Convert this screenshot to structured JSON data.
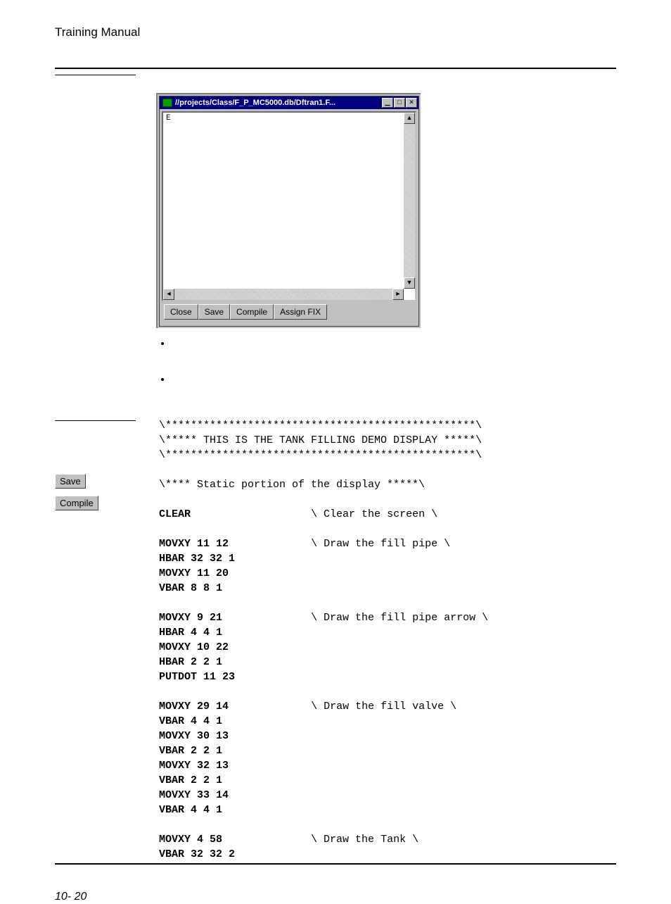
{
  "header": {
    "title": "Training Manual"
  },
  "window": {
    "title": "//projects/Class/F_P_MC5000.db/Dftran1.F...",
    "textpane_content": "E",
    "buttons": {
      "close": "Close",
      "save": "Save",
      "compile": "Compile",
      "assign": "Assign FIX"
    }
  },
  "bullets": {
    "b1": "",
    "b2": ""
  },
  "sidebar": {
    "btn_save": "Save",
    "btn_compile": "Compile"
  },
  "code": {
    "sep1": "\\*************************************************\\",
    "title": "\\***** THIS IS THE TANK FILLING DEMO DISPLAY *****\\",
    "sep2": "\\*************************************************\\",
    "static": "\\**** Static portion of the display *****\\",
    "clear": "CLEAR",
    "clear_c": "\\ Clear the screen \\",
    "fp1": "MOVXY 11 12",
    "fp1c": "\\ Draw the fill pipe \\",
    "fp2": "HBAR 32 32 1",
    "fp3": "MOVXY 11 20",
    "fp4": "VBAR 8 8 1",
    "fa1": "MOVXY 9 21",
    "fa1c": "\\ Draw the fill pipe arrow \\",
    "fa2": "HBAR 4 4 1",
    "fa3": "MOVXY 10 22",
    "fa4": "HBAR 2 2 1",
    "fa5": "PUTDOT 11 23",
    "fv1": "MOVXY 29 14",
    "fv1c": "\\ Draw the fill valve \\",
    "fv2": "VBAR 4 4 1",
    "fv3": "MOVXY 30 13",
    "fv4": "VBAR 2 2 1",
    "fv5": "MOVXY 32 13",
    "fv6": "VBAR 2 2 1",
    "fv7": "MOVXY 33 14",
    "fv8": "VBAR 4 4 1",
    "tk1": "MOVXY 4 58",
    "tk1c": "\\ Draw the Tank \\",
    "tk2": "VBAR 32 32 2"
  },
  "footer": {
    "pagenum": "10- 20"
  }
}
